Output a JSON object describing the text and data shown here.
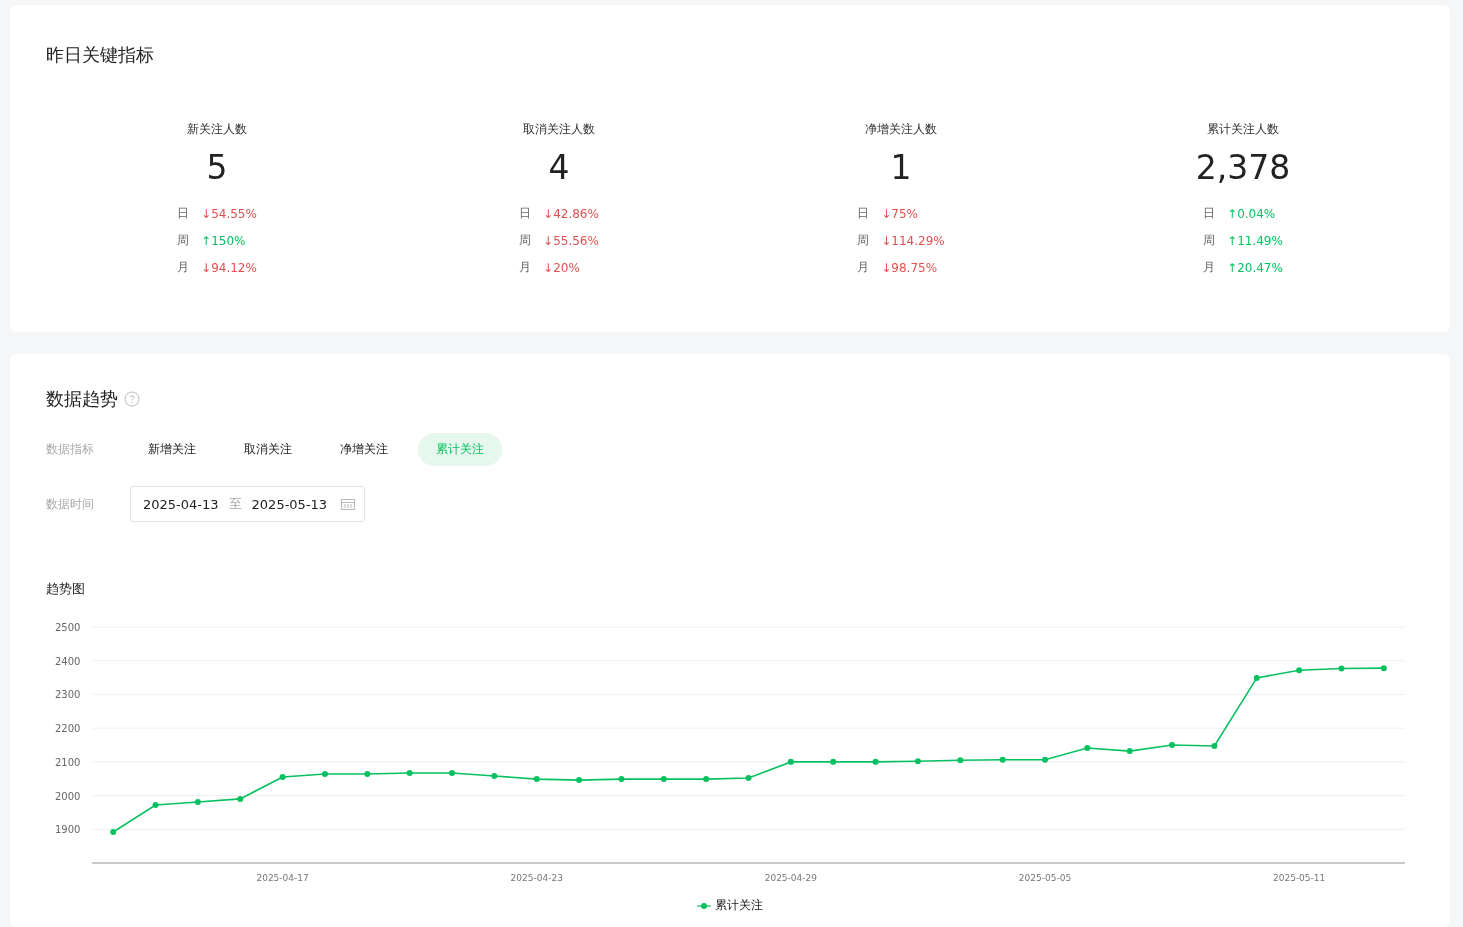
{
  "key_metrics": {
    "title": "昨日关键指标",
    "items": [
      {
        "label": "新关注人数",
        "value": "5",
        "compare": [
          {
            "label": "日",
            "value": "↓54.55%",
            "color": "#e0504f"
          },
          {
            "label": "周",
            "value": "↑150%",
            "color": "#07c160"
          },
          {
            "label": "月",
            "value": "↓94.12%",
            "color": "#e0504f"
          }
        ]
      },
      {
        "label": "取消关注人数",
        "value": "4",
        "compare": [
          {
            "label": "日",
            "value": "↓42.86%",
            "color": "#e0504f"
          },
          {
            "label": "周",
            "value": "↓55.56%",
            "color": "#e0504f"
          },
          {
            "label": "月",
            "value": "↓20%",
            "color": "#e0504f"
          }
        ]
      },
      {
        "label": "净增关注人数",
        "value": "1",
        "compare": [
          {
            "label": "日",
            "value": "↓75%",
            "color": "#e0504f"
          },
          {
            "label": "周",
            "value": "↓114.29%",
            "color": "#e0504f"
          },
          {
            "label": "月",
            "value": "↓98.75%",
            "color": "#e0504f"
          }
        ]
      },
      {
        "label": "累计关注人数",
        "value": "2,378",
        "compare": [
          {
            "label": "日",
            "value": "↑0.04%",
            "color": "#07c160"
          },
          {
            "label": "周",
            "value": "↑11.49%",
            "color": "#07c160"
          },
          {
            "label": "月",
            "value": "↑20.47%",
            "color": "#07c160"
          }
        ]
      }
    ]
  },
  "trend": {
    "title": "数据趋势",
    "indicator_label": "数据指标",
    "indicators": [
      {
        "label": "新增关注",
        "selected": false
      },
      {
        "label": "取消关注",
        "selected": false
      },
      {
        "label": "净增关注",
        "selected": false
      },
      {
        "label": "累计关注",
        "selected": true
      }
    ],
    "time_label": "数据时间",
    "date_range": {
      "start": "2025-04-13",
      "separator": "至",
      "end": "2025-05-13"
    },
    "chart_title": "趋势图",
    "chart_data": {
      "type": "line",
      "grid": true,
      "ylim": [
        1800,
        2500
      ],
      "yticks": [
        1900,
        2000,
        2100,
        2200,
        2300,
        2400,
        2500
      ],
      "categories": [
        null,
        null,
        null,
        null,
        "2025-04-17",
        null,
        null,
        null,
        null,
        null,
        "2025-04-23",
        null,
        null,
        null,
        null,
        null,
        "2025-04-29",
        null,
        null,
        null,
        null,
        null,
        "2025-05-05",
        null,
        null,
        null,
        null,
        null,
        "2025-05-11",
        null,
        null
      ],
      "series": [
        {
          "name": "累计关注",
          "color": "#07c160",
          "marker": true,
          "values": [
            1892,
            1972,
            1981,
            1990,
            2055,
            2064,
            2064,
            2067,
            2067,
            2058,
            2049,
            2046,
            2049,
            2049,
            2049,
            2052,
            2100,
            2100,
            2100,
            2102,
            2105,
            2106,
            2106,
            2141,
            2132,
            2150,
            2147,
            2349,
            2372,
            2377,
            2378
          ]
        }
      ]
    }
  }
}
